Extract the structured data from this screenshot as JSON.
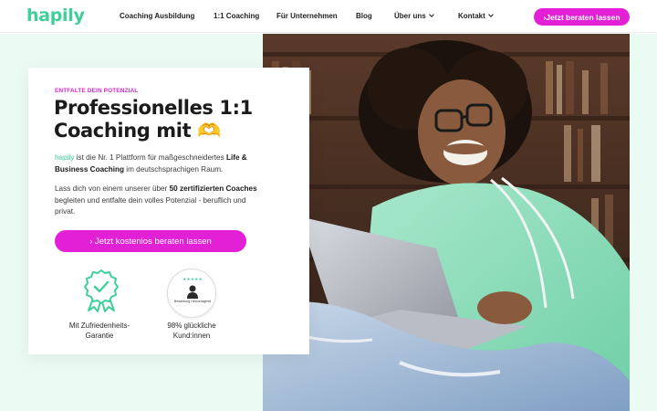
{
  "brand": {
    "logo": "hapily",
    "accent": "#3fcf98",
    "cta_color": "#e221d6"
  },
  "nav": {
    "items": [
      {
        "label": "Coaching Ausbildung"
      },
      {
        "label": "1:1 Coaching"
      },
      {
        "label": "Für Unternehmen"
      },
      {
        "label": "Blog"
      },
      {
        "label": "Über uns"
      },
      {
        "label": "Kontakt"
      }
    ],
    "cta": "›Jetzt beraten lassen"
  },
  "hero": {
    "eyebrow": "ENTFALTE DEIN POTENZIAL",
    "headline": "Professionelles 1:1 Coaching mit 🫶",
    "p1_brand": "hapily",
    "p1_text": " ist die Nr. 1 Plattform für maßgeschneidertes ",
    "p1_bold": "Life & Business Coaching",
    "p1_end": " im deutschsprachigen Raum.",
    "p2_start": "Lass dich von einem unserer über ",
    "p2_bold": "50 zertifizierten Coaches",
    "p2_end": " begleiten und entfalte dein volles Potenzial - beruflich und privat.",
    "cta": "› Jetzt kostenlos beraten lassen",
    "badges": [
      {
        "label": "Mit Zufriedenheits-Garantie",
        "icon": "award-ribbon-icon"
      },
      {
        "label": "98% glückliche Kund:innen",
        "icon": "rating-seal-icon",
        "stars": "★★★★★",
        "seal_text": "Bewertung Hervorragend"
      }
    ]
  }
}
